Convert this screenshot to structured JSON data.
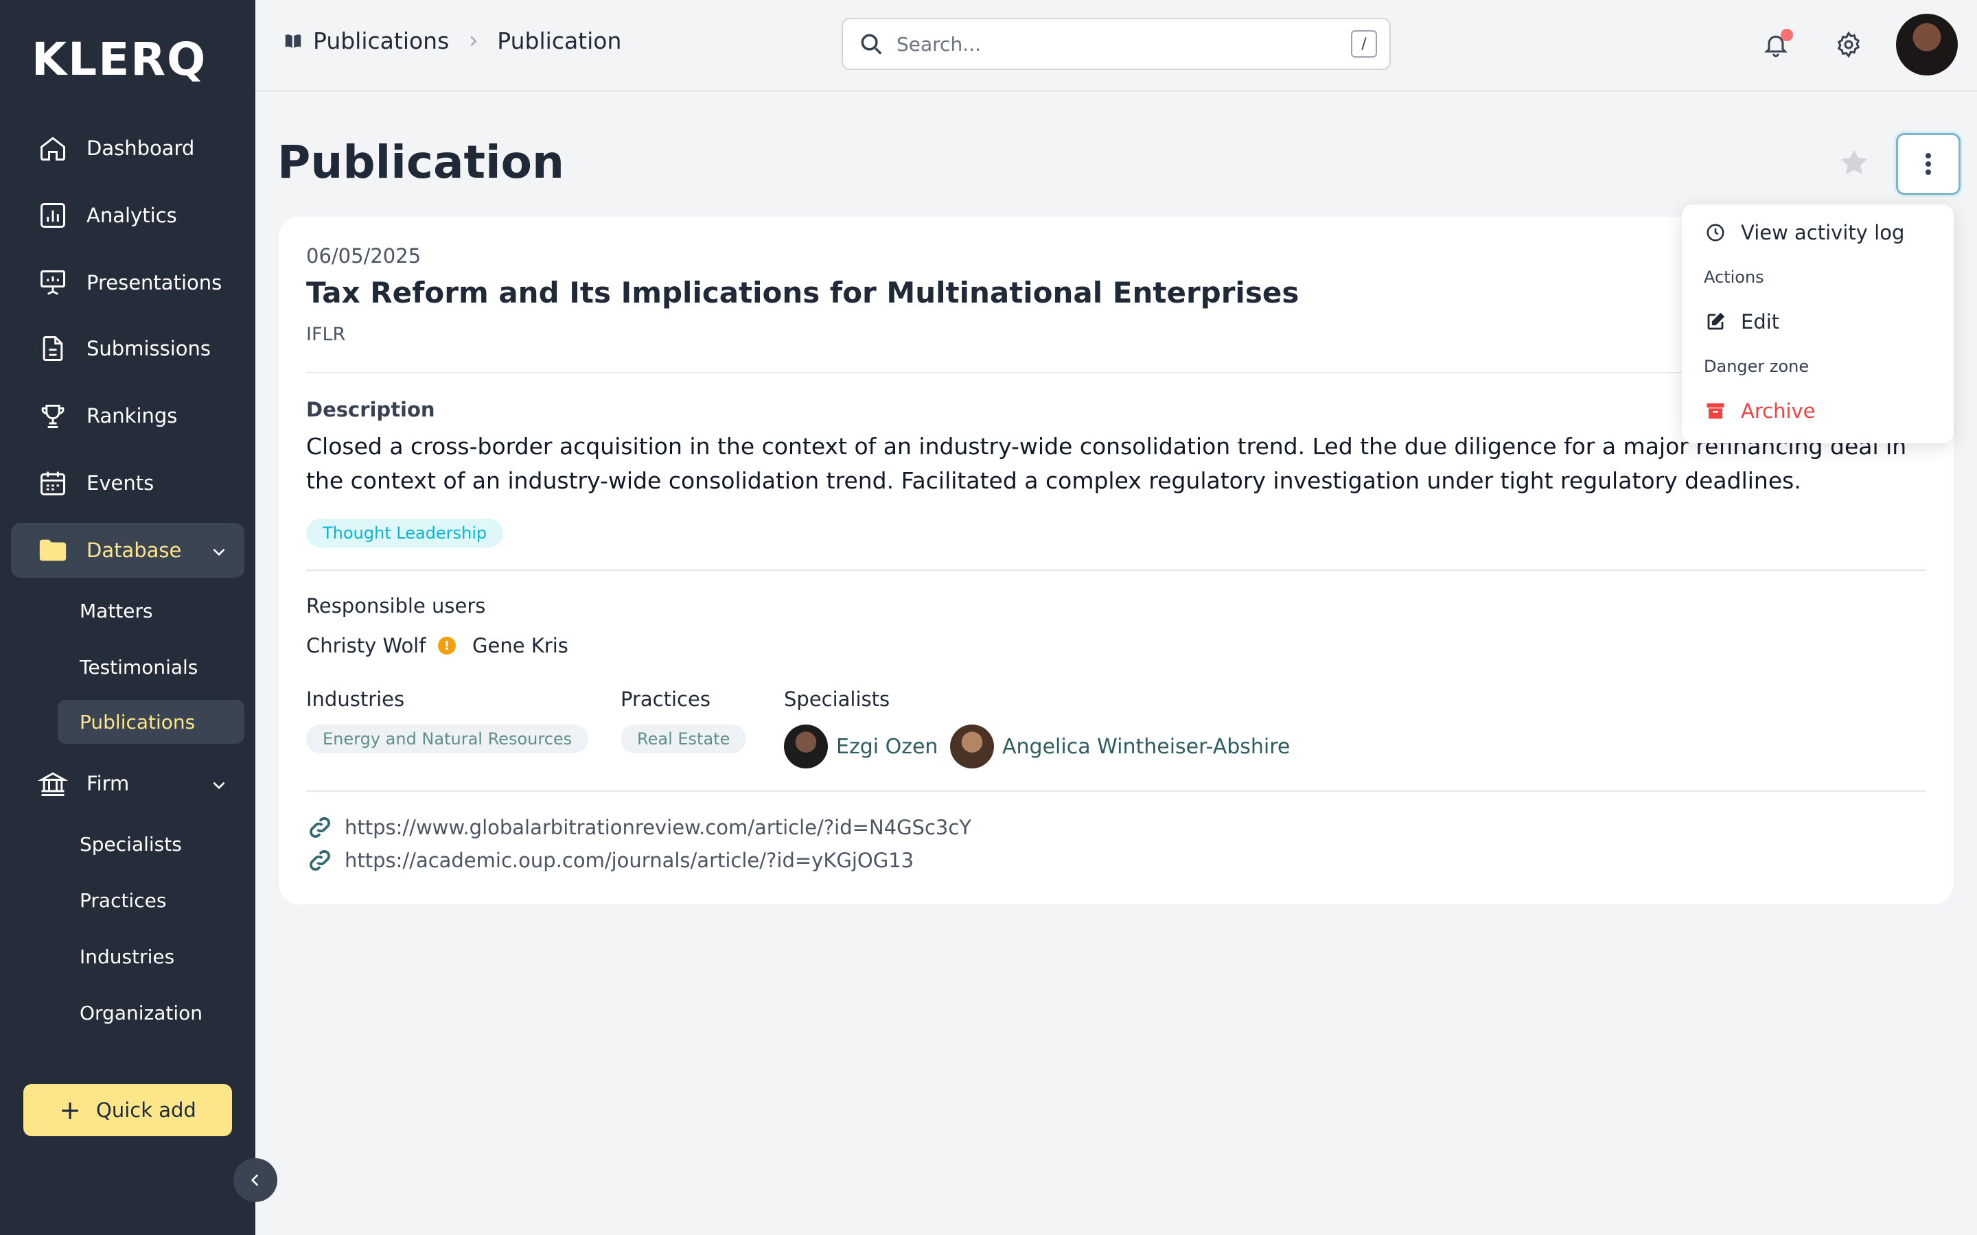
{
  "app": {
    "logo": "KLERQ"
  },
  "sidebar": {
    "items": [
      {
        "label": "Dashboard",
        "icon": "home-icon"
      },
      {
        "label": "Analytics",
        "icon": "chart-icon"
      },
      {
        "label": "Presentations",
        "icon": "presentation-icon"
      },
      {
        "label": "Submissions",
        "icon": "document-icon"
      },
      {
        "label": "Rankings",
        "icon": "trophy-icon"
      },
      {
        "label": "Events",
        "icon": "calendar-icon"
      },
      {
        "label": "Database",
        "icon": "folder-icon",
        "active": true
      },
      {
        "label": "Firm",
        "icon": "bank-icon"
      }
    ],
    "database_sub": [
      "Matters",
      "Testimonials",
      "Publications"
    ],
    "firm_sub": [
      "Specialists",
      "Practices",
      "Industries",
      "Organization"
    ],
    "quick_add": "Quick add"
  },
  "topbar": {
    "breadcrumb": [
      "Publications",
      "Publication"
    ],
    "search_placeholder": "Search...",
    "search_shortcut": "/"
  },
  "page": {
    "title": "Publication"
  },
  "publication": {
    "date": "06/05/2025",
    "title": "Tax Reform and Its Implications for Multinational Enterprises",
    "outlet": "IFLR",
    "description_label": "Description",
    "description": "Closed a cross-border acquisition in the context of an industry-wide consolidation trend. Led the due diligence for a major refinancing deal in the context of an industry-wide consolidation trend. Facilitated a complex regulatory investigation under tight regulatory deadlines.",
    "tag": "Thought Leadership",
    "responsible_label": "Responsible users",
    "responsible_users": [
      "Christy Wolf",
      "Gene Kris"
    ],
    "industries_label": "Industries",
    "industries": [
      "Energy and Natural Resources"
    ],
    "practices_label": "Practices",
    "practices": [
      "Real Estate"
    ],
    "specialists_label": "Specialists",
    "specialists": [
      "Ezgi Ozen",
      "Angelica Wintheiser-Abshire"
    ],
    "links": [
      "https://www.globalarbitrationreview.com/article/?id=N4GSc3cY",
      "https://academic.oup.com/journals/article/?id=yKGjOG13"
    ]
  },
  "menu": {
    "view_activity": "View activity log",
    "actions_label": "Actions",
    "edit": "Edit",
    "danger_label": "Danger zone",
    "archive": "Archive"
  },
  "colors": {
    "sidebar": "#252d3a",
    "accent": "#fde68a",
    "danger": "#ef4444",
    "tag": "#06b6d4"
  }
}
